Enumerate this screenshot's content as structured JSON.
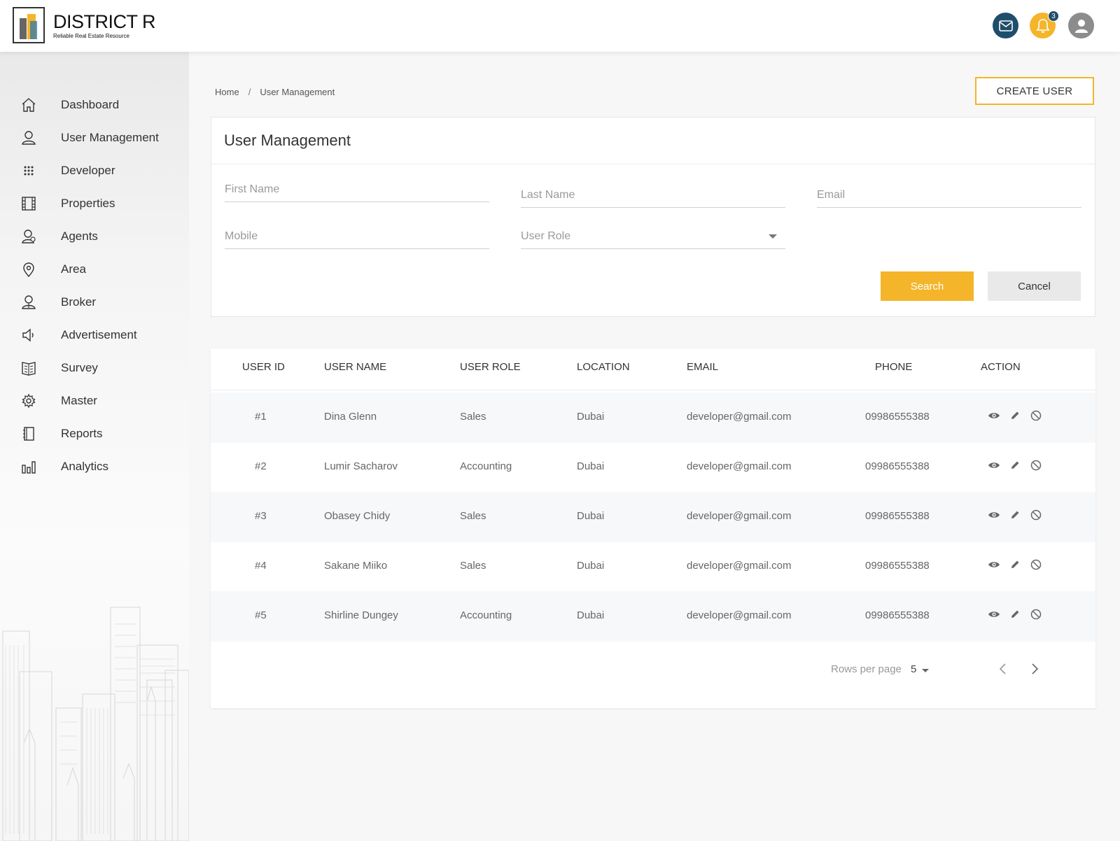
{
  "brand": {
    "name": "DISTRICT R",
    "tagline": "Reliable Real Estate Resource",
    "accent": "#f4b52a",
    "navy": "#1f4e6b"
  },
  "header": {
    "notification_count": "3",
    "icons": [
      "mail-icon",
      "bell-icon",
      "user-icon"
    ]
  },
  "sidebar": {
    "items": [
      {
        "label": "Dashboard",
        "icon": "home-icon"
      },
      {
        "label": "User Management",
        "icon": "user-icon"
      },
      {
        "label": "Developer",
        "icon": "grid-icon"
      },
      {
        "label": "Properties",
        "icon": "building-icon"
      },
      {
        "label": "Agents",
        "icon": "agents-icon"
      },
      {
        "label": "Area",
        "icon": "location-pin-icon"
      },
      {
        "label": "Broker",
        "icon": "broker-icon"
      },
      {
        "label": "Advertisement",
        "icon": "megaphone-icon"
      },
      {
        "label": "Survey",
        "icon": "survey-icon"
      },
      {
        "label": "Master",
        "icon": "gear-icon"
      },
      {
        "label": "Reports",
        "icon": "notebook-icon"
      },
      {
        "label": "Analytics",
        "icon": "bar-chart-icon"
      }
    ]
  },
  "breadcrumb": {
    "home": "Home",
    "separator": "/",
    "current": "User Management"
  },
  "create_button": "CREATE USER",
  "filter_panel": {
    "title": "User Management",
    "first_name_placeholder": "First Name",
    "last_name_placeholder": "Last Name",
    "email_placeholder": "Email",
    "mobile_placeholder": "Mobile",
    "user_role_placeholder": "User Role",
    "search_label": "Search",
    "cancel_label": "Cancel"
  },
  "table": {
    "columns": [
      "USER ID",
      "USER NAME",
      "USER ROLE",
      "LOCATION",
      "EMAIL",
      "PHONE",
      "ACTION"
    ],
    "rows": [
      {
        "id": "#1",
        "name": "Dina Glenn",
        "role": "Sales",
        "location": "Dubai",
        "email": "developer@gmail.com",
        "phone": "09986555388"
      },
      {
        "id": "#2",
        "name": "Lumir Sacharov",
        "role": "Accounting",
        "location": "Dubai",
        "email": "developer@gmail.com",
        "phone": "09986555388"
      },
      {
        "id": "#3",
        "name": "Obasey Chidy",
        "role": "Sales",
        "location": "Dubai",
        "email": "developer@gmail.com",
        "phone": "09986555388"
      },
      {
        "id": "#4",
        "name": "Sakane Miiko",
        "role": "Sales",
        "location": "Dubai",
        "email": "developer@gmail.com",
        "phone": "09986555388"
      },
      {
        "id": "#5",
        "name": "Shirline Dungey",
        "role": "Accounting",
        "location": "Dubai",
        "email": "developer@gmail.com",
        "phone": "09986555388"
      }
    ],
    "row_actions": [
      "view-icon",
      "edit-icon",
      "block-icon"
    ]
  },
  "pagination": {
    "rows_per_page_label": "Rows per page",
    "rows_per_page_value": "5"
  }
}
